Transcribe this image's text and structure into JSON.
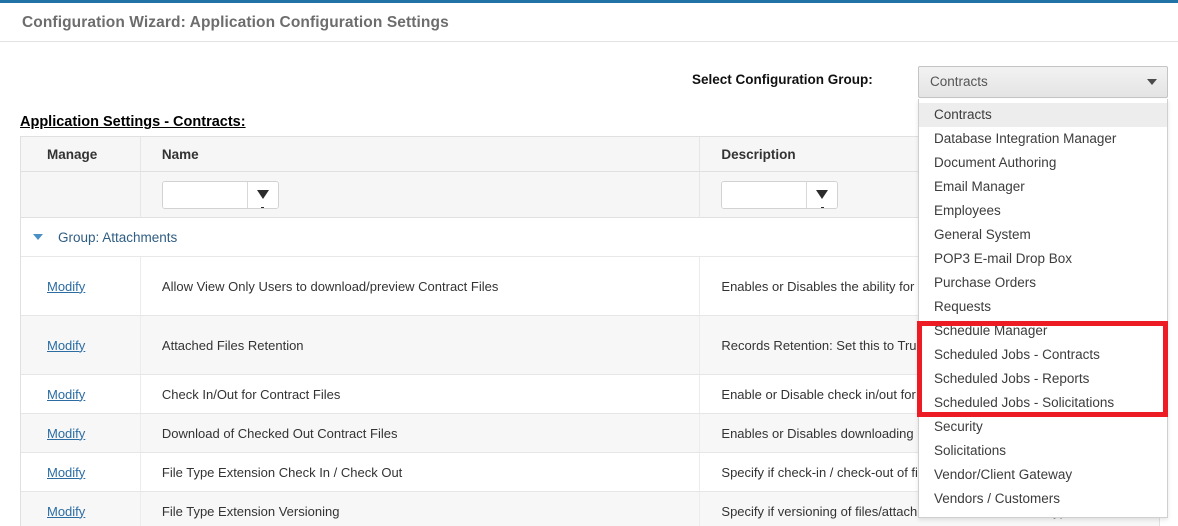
{
  "header": {
    "title": "Configuration Wizard: Application Configuration Settings",
    "accent_color": "#2273a5"
  },
  "config_group": {
    "label": "Select Configuration Group:",
    "selected": "Contracts",
    "arrow_icon": "chevron-down-icon",
    "options": [
      "Contracts",
      "Database Integration Manager",
      "Document Authoring",
      "Email Manager",
      "Employees",
      "General System",
      "POP3 E-mail Drop Box",
      "Purchase Orders",
      "Requests",
      "Schedule Manager",
      "Scheduled Jobs - Contracts",
      "Scheduled Jobs - Reports",
      "Scheduled Jobs - Solicitations",
      "Security",
      "Solicitations",
      "Vendor/Client Gateway",
      "Vendors / Customers"
    ],
    "highlight": {
      "color": "#ed1c24",
      "options": [
        "Schedule Manager",
        "Scheduled Jobs - Contracts",
        "Scheduled Jobs - Reports",
        "Scheduled Jobs - Solicitations"
      ]
    }
  },
  "section": {
    "heading": "Application Settings - Contracts:"
  },
  "grid": {
    "columns": [
      "Manage",
      "Name",
      "Description"
    ],
    "filter": {
      "name_value": "",
      "description_value": "",
      "filter_icon": "funnel-icon"
    },
    "group": {
      "caret_icon": "caret-down-icon",
      "label": "Group: Attachments"
    },
    "rows": [
      {
        "manage": "Modify",
        "name": "Allow View Only Users to download/preview Contract Files",
        "description": "Enables or Disables the ability for the record) to download/preview fil"
      },
      {
        "manage": "Modify",
        "name": "Attached Files Retention",
        "description": "Records Retention: Set this to Tru Files even if the Contract Record i"
      },
      {
        "manage": "Modify",
        "name": "Check In/Out for Contract Files",
        "description": "Enable or Disable check in/out for"
      },
      {
        "manage": "Modify",
        "name": "Download of Checked Out Contract Files",
        "description": "Enables or Disables downloading"
      },
      {
        "manage": "Modify",
        "name": "File Type Extension Check In / Check Out",
        "description": "Specify if check-in / check-out of fi"
      },
      {
        "manage": "Modify",
        "name": "File Type Extension Versioning",
        "description": "Specify if versioning of files/attachments includes the file type extension"
      }
    ]
  }
}
